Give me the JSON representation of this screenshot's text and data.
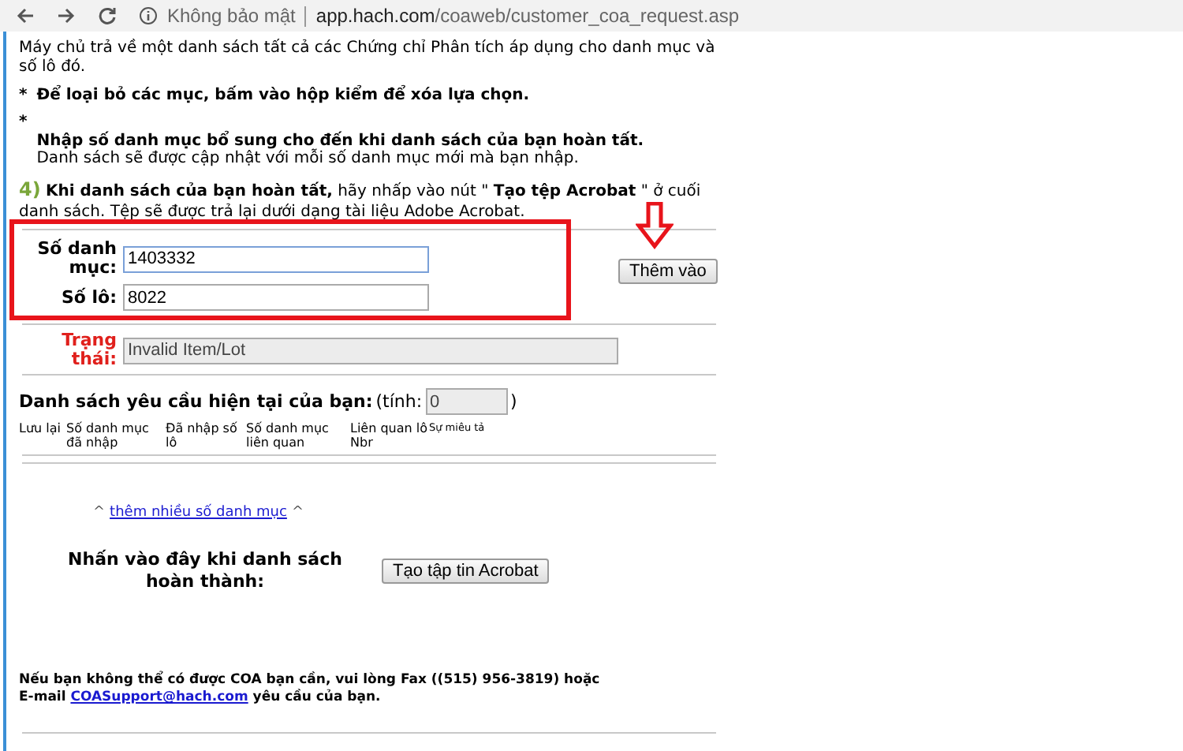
{
  "browser": {
    "security": "Không bảo mật",
    "url_host": "app.hach.com",
    "url_path": "/coaweb/customer_coa_request.asp"
  },
  "intro": "Máy chủ trả về một danh sách tất cả các Chứng chỉ Phân tích áp dụng cho danh mục và số lô đó.",
  "bullets": [
    {
      "mark": "*",
      "title": "Để loại bỏ các mục, bấm vào hộp kiểm để xóa lựa chọn.",
      "newline": false
    },
    {
      "mark": "*",
      "title": "Nhập số danh mục bổ sung cho đến khi danh sách của bạn hoàn tất.",
      "note": "Danh sách sẽ được cập nhật với mỗi số danh mục mới mà bạn nhập.",
      "newline": true
    }
  ],
  "step": {
    "number": "4)",
    "text": "**Khi danh sách của bạn hoàn tất,** hãy nhấp vào nút \" **Tạo tệp Acrobat** \" ở cuối danh sách. Tệp sẽ được trả lại dưới dạng tài liệu Adobe Acrobat."
  },
  "fields": [
    {
      "label": "Số danh mục:",
      "value": "1403332",
      "focused": true
    },
    {
      "label": "Số lô:",
      "value": "8022",
      "focused": false
    }
  ],
  "add_button": "Thêm vào",
  "status": {
    "label": "Trạng thái:",
    "value": "Invalid Item/Lot"
  },
  "list": {
    "title": "Danh sách yêu cầu hiện tại của bạn:",
    "count_label": "(tính:",
    "count": "0",
    "count_close": ")",
    "columns": [
      "Lưu lại",
      "Số danh mục đã nhập",
      "Đã nhập số lô",
      "Số danh mục liên quan",
      "Liên quan lô Nbr",
      "Sự miêu tả"
    ]
  },
  "more_link": {
    "left": "^",
    "text": "thêm nhiều số danh mục",
    "right": "^"
  },
  "complete": {
    "label": "Nhấn vào đây khi danh sách hoàn thành:",
    "button": "Tạo tập tin Acrobat"
  },
  "footer": {
    "before": "Nếu bạn không thể có được COA bạn cần, vui lòng Fax ((515) 956-3819) hoặc E-mail",
    "email": "COASupport@hach.com",
    "after": "yêu cầu của bạn."
  }
}
